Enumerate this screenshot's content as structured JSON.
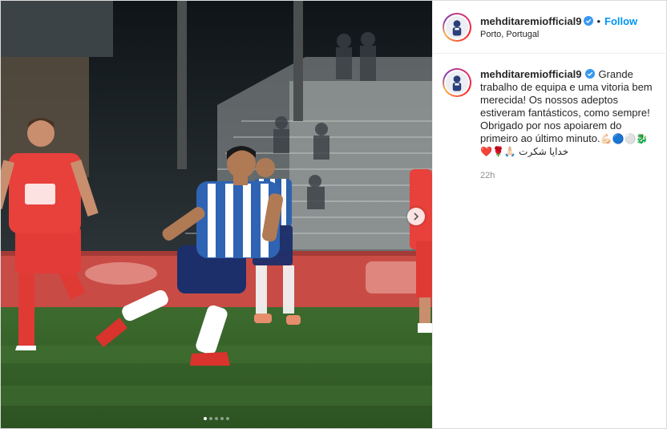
{
  "post": {
    "carousel": {
      "slide_count": 5,
      "active_index": 0
    },
    "header": {
      "username": "mehditaremiofficial9",
      "separator": "•",
      "follow_label": "Follow",
      "location": "Porto, Portugal"
    },
    "caption": {
      "username": "mehditaremiofficial9",
      "text": "Grande trabalho de equipa e uma vitoria bem merecida! Os nossos adeptos estiveram fantásticos, como sempre! Obrigado por nos apoiarem do primeiro ao último minuto.",
      "emoji_line_1": "💪🏻🔵⚪🐉",
      "emoji_line_2": "❤️🌹🙏🏻 خدایا شکرت",
      "time": "22h"
    },
    "colors": {
      "follow": "#0095f6",
      "verified": "#3897f0",
      "muted": "#8e8e8e"
    }
  }
}
